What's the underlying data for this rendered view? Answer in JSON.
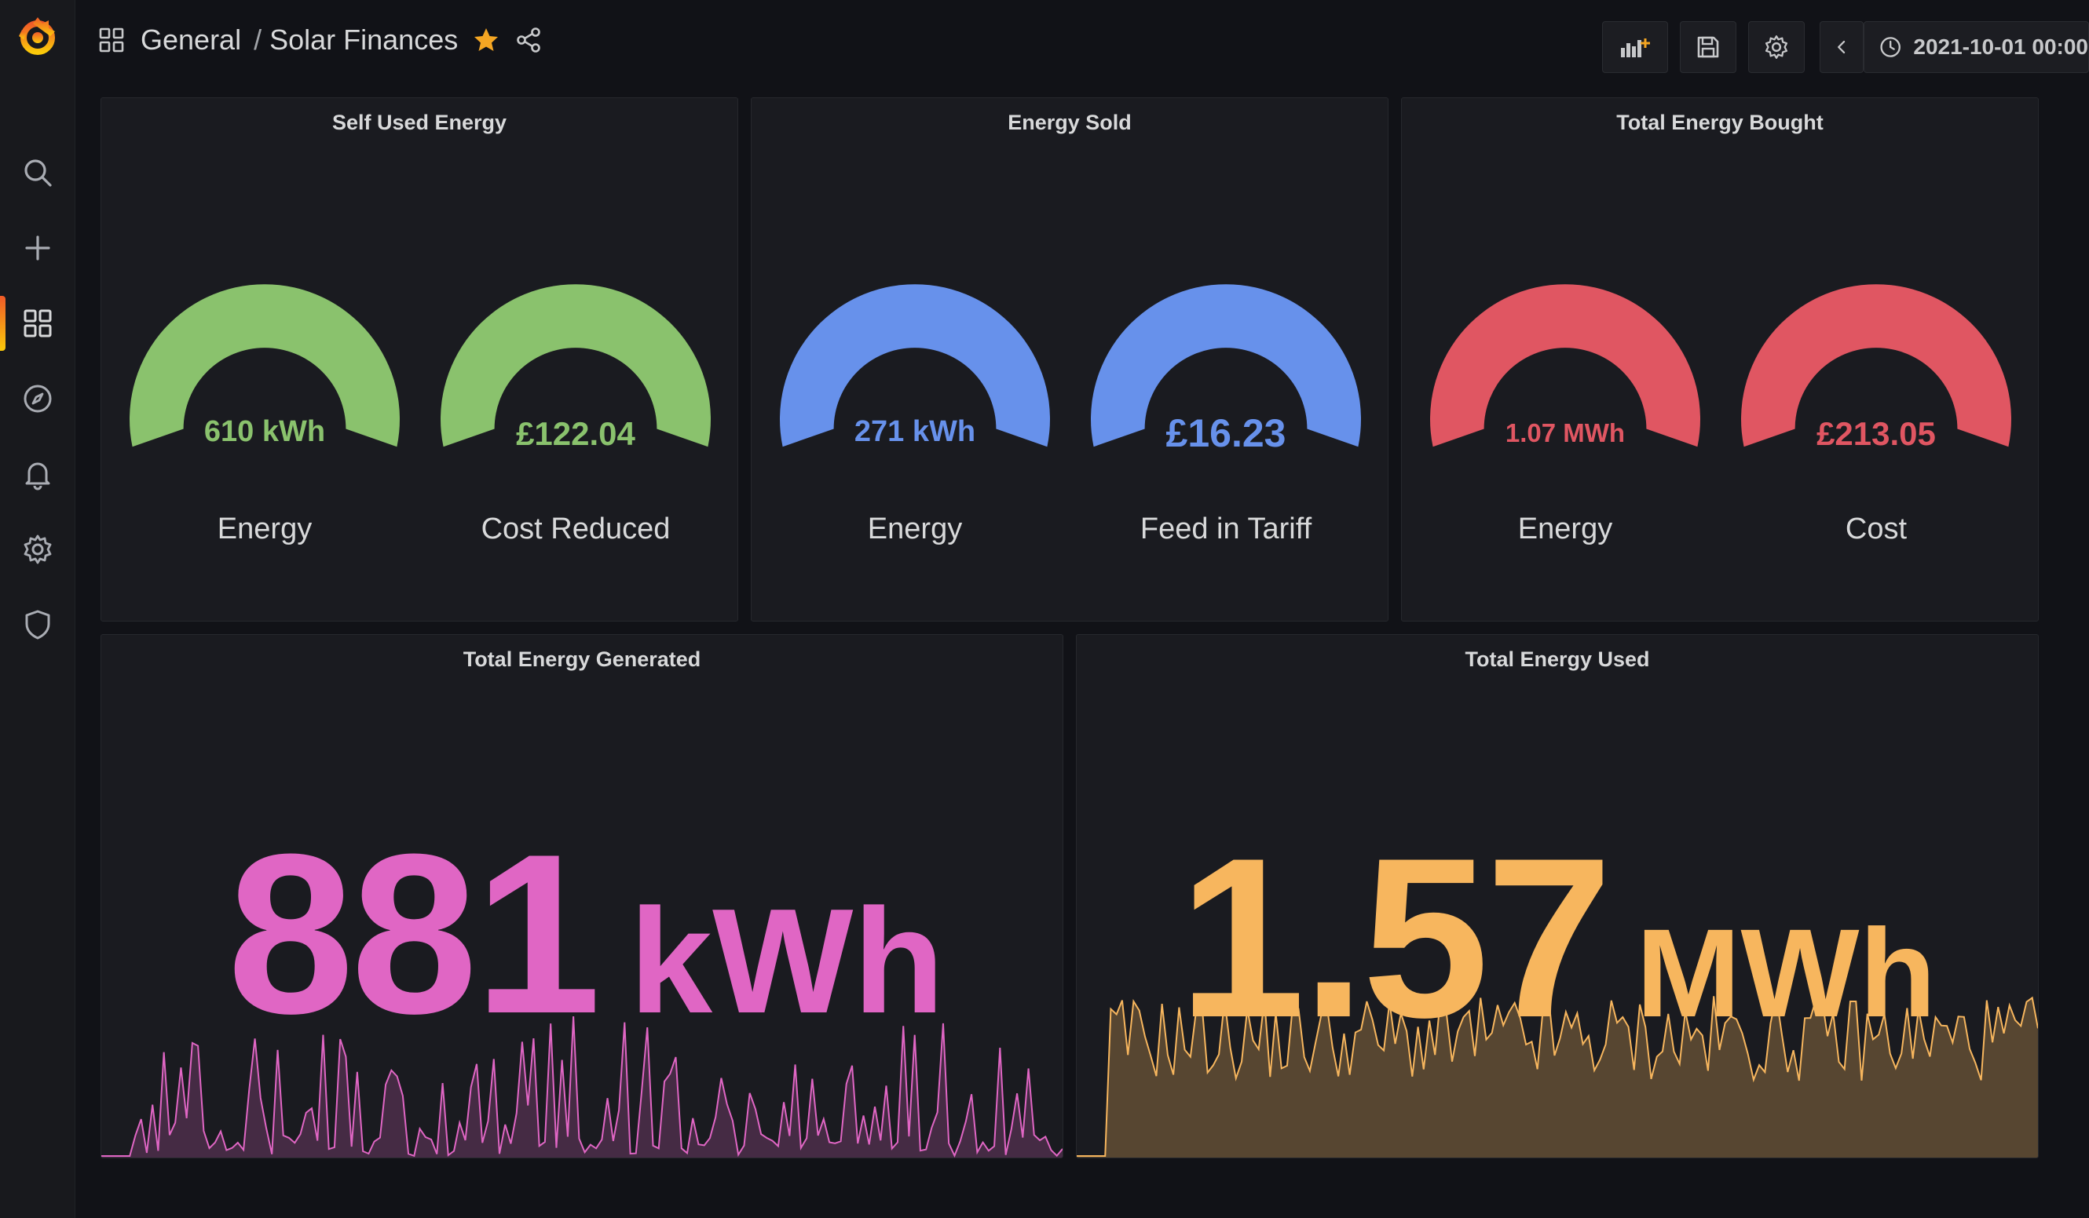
{
  "breadcrumb": {
    "folder": "General",
    "separator": "/",
    "dashboard": "Solar Finances"
  },
  "toolbar": {
    "time_range": "2021-10-01 00:00"
  },
  "icons": {
    "logo": "grafana-logo-icon",
    "sidebar": [
      "search-icon",
      "plus-icon",
      "dashboards-icon",
      "explore-compass-icon",
      "alerting-bell-icon",
      "settings-gear-icon",
      "shield-icon"
    ],
    "toolbar": [
      "add-panel-icon",
      "save-icon",
      "settings-gear-icon",
      "chevron-left-icon",
      "clock-icon"
    ]
  },
  "colors": {
    "green": "#8ac26d",
    "blue": "#6791eb",
    "red": "#e05662",
    "pink": "#e066c4",
    "orange": "#f7b65e",
    "star": "#f5a623",
    "background": "#111217",
    "panel": "#1a1b20"
  },
  "panels": {
    "self_used": {
      "title": "Self Used Energy",
      "gauges": [
        {
          "value": "610 kWh",
          "label": "Energy"
        },
        {
          "value": "£122.04",
          "label": "Cost Reduced"
        }
      ]
    },
    "energy_sold": {
      "title": "Energy Sold",
      "gauges": [
        {
          "value": "271 kWh",
          "label": "Energy"
        },
        {
          "value": "£16.23",
          "label": "Feed in Tariff"
        }
      ]
    },
    "energy_bought": {
      "title": "Total Energy Bought",
      "gauges": [
        {
          "value": "1.07 MWh",
          "label": "Energy"
        },
        {
          "value": "£213.05",
          "label": "Cost"
        }
      ]
    },
    "generated": {
      "title": "Total Energy Generated",
      "number": "881",
      "unit": "kWh"
    },
    "used": {
      "title": "Total Energy Used",
      "number": "1.57",
      "unit": "MWh"
    }
  }
}
